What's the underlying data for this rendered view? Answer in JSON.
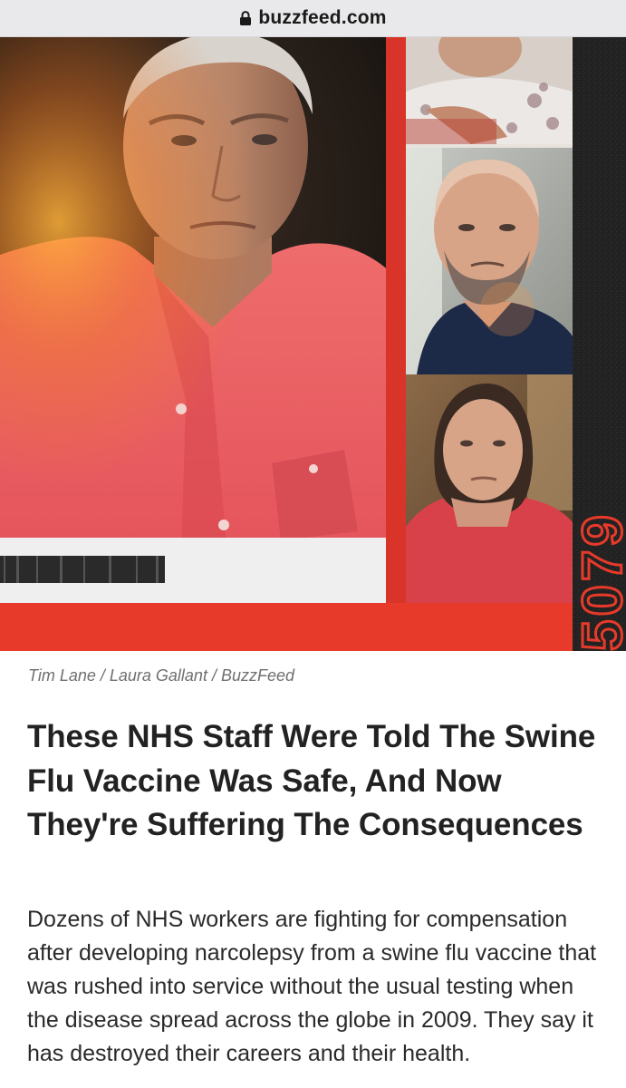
{
  "browser": {
    "domain": "buzzfeed.com",
    "icon": "lock-icon"
  },
  "hero": {
    "stamp_text": "5079",
    "colors": {
      "accent_red": "#e83a2a",
      "shirt_red": "#e95a5e",
      "dark_band": "#1f1f1f"
    }
  },
  "article": {
    "photo_credit": "Tim Lane / Laura Gallant / BuzzFeed",
    "headline": "These NHS Staff Were Told The Swine Flu Vaccine Was Safe, And Now They're Suffering The Consequences",
    "dek": "Dozens of NHS workers are fighting for compensation after developing narcolepsy from a swine flu vaccine that was rushed into service without the usual testing when the disease spread across the globe in 2009. They say it has destroyed their careers and their health."
  }
}
